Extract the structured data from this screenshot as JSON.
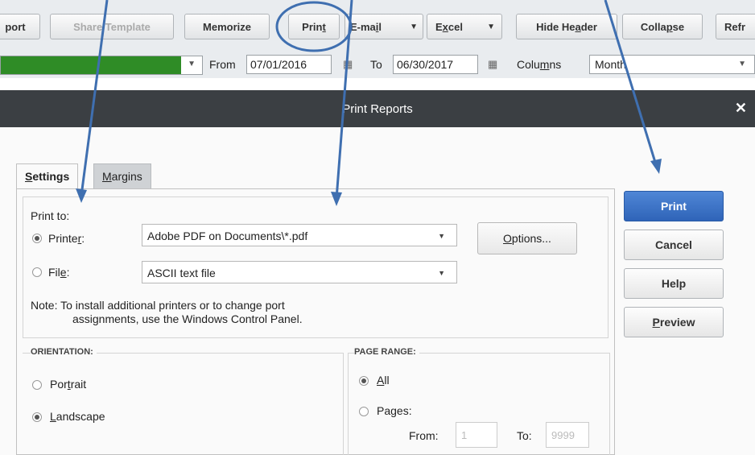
{
  "toolbar": {
    "export_partial": "port",
    "share_template": "Share Template",
    "memorize": "Memorize",
    "print_pre": "Prin",
    "print_u": "t",
    "email_pre": "E-ma",
    "email_u": "i",
    "email_post": "l",
    "excel_pre": "E",
    "excel_u": "x",
    "excel_post": "cel",
    "hide_header_pre": "Hide He",
    "hide_header_u": "a",
    "hide_header_post": "der",
    "collapse_pre": "Colla",
    "collapse_u": "p",
    "collapse_post": "se",
    "refresh_partial": "Refr"
  },
  "filters": {
    "from_label": "From",
    "from_value": "07/01/2016",
    "to_label": "To",
    "to_value": "06/30/2017",
    "columns_pre": "Colu",
    "columns_u": "m",
    "columns_post": "ns",
    "columns_value": "Month",
    "range_color": "#2f8c26"
  },
  "dialog": {
    "title": "Print Reports",
    "tabs": {
      "settings_u": "S",
      "settings_post": "ettings",
      "margins_u": "M",
      "margins_post": "argins"
    },
    "print_to_label": "Print to:",
    "printer_pre": "Printe",
    "printer_u": "r",
    "printer_post": ":",
    "printer_value": "Adobe PDF on Documents\\*.pdf",
    "file_pre": "Fil",
    "file_u": "e",
    "file_post": ":",
    "file_value": "ASCII text file",
    "options_u": "O",
    "options_post": "ptions...",
    "note_line1": "Note: To install additional printers or to change port",
    "note_line2": "assignments, use the Windows Control Panel.",
    "orientation_title": "ORIENTATION:",
    "portrait_pre": "Por",
    "portrait_u": "t",
    "portrait_post": "rait",
    "landscape_u": "L",
    "landscape_post": "andscape",
    "page_range_title": "PAGE RANGE:",
    "all_u": "A",
    "all_post": "ll",
    "pages_pre": "Pa",
    "pages_u": "g",
    "pages_post": "es:",
    "from_label": "From:",
    "from_value": "1",
    "to_label": "To:",
    "to_value": "9999",
    "buttons": {
      "print": "Print",
      "cancel": "Cancel",
      "help": "Help",
      "preview_u": "P",
      "preview_post": "review"
    },
    "selected_printer_option": "printer",
    "selected_orientation": "landscape",
    "selected_page_range": "all"
  },
  "colors": {
    "annotation_blue": "#3f6fb0",
    "titlebar": "#3b3f43",
    "primary_button": "#2f64b8"
  }
}
